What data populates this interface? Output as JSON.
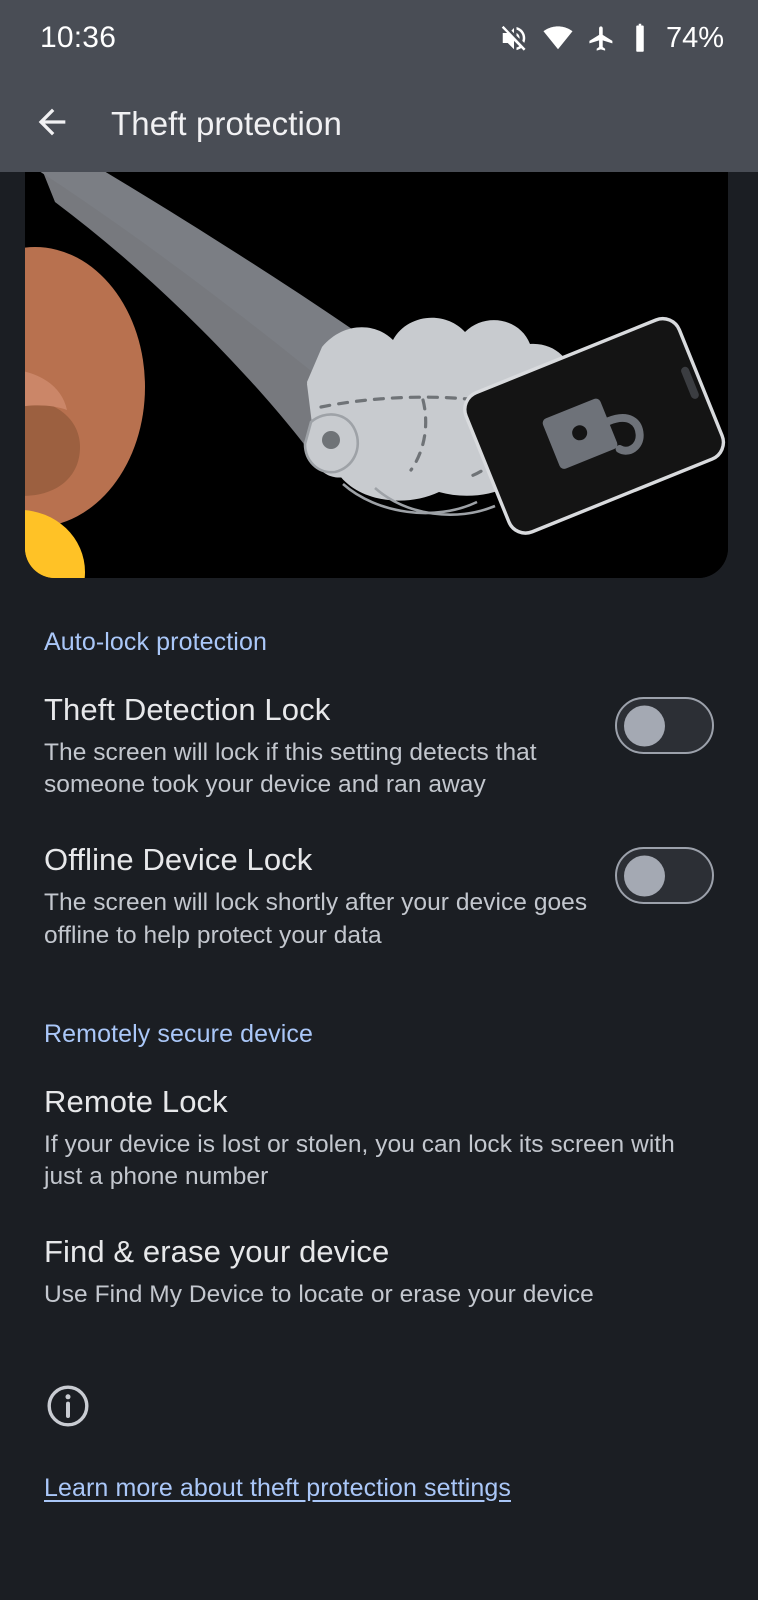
{
  "status_bar": {
    "clock": "10:36",
    "battery_percent": "74%",
    "icons": [
      "volume-off-icon",
      "wifi-icon",
      "airplane-mode-icon",
      "battery-icon"
    ]
  },
  "app_bar": {
    "title": "Theft protection",
    "back_icon": "arrow-back-icon",
    "overflow_icon": "more-vert-icon"
  },
  "hero": {
    "illustration_name": "theft-protection-illustration",
    "description": "Gloved hand snatching a locked phone from a person's hand",
    "colors": {
      "background": "#000000",
      "arm": "#7a7d82",
      "glove": "#c8cbcf",
      "skin": "#b8714f",
      "skin_shadow": "#8f563a",
      "sleeve": "#ffc226",
      "phone": "#141414",
      "lock": "#6e7279"
    }
  },
  "sections": [
    {
      "header": "Auto-lock protection",
      "items": [
        {
          "title": "Theft Detection Lock",
          "summary": "The screen will lock if this setting detects that someone took your device and ran away",
          "has_toggle": true,
          "toggle_state": "off"
        },
        {
          "title": "Offline Device Lock",
          "summary": "The screen will lock shortly after your device goes offline to help protect your data",
          "has_toggle": true,
          "toggle_state": "off"
        }
      ]
    },
    {
      "header": "Remotely secure device",
      "items": [
        {
          "title": "Remote Lock",
          "summary": "If your device is lost or stolen, you can lock its screen with just a phone number",
          "has_toggle": false,
          "toggle_state": ""
        },
        {
          "title": "Find & erase your device",
          "summary": "Use Find My Device to locate or erase your device",
          "has_toggle": false,
          "toggle_state": ""
        }
      ]
    }
  ],
  "footer": {
    "info_icon": "info-outline-icon",
    "learn_more_label": "Learn more about theft protection settings"
  },
  "theme": {
    "background": "#1b1e23",
    "app_bar_background": "#494d55",
    "accent_link": "#aac7f8",
    "primary_text": "#e7e8ea",
    "secondary_text": "#c3c7ce"
  }
}
